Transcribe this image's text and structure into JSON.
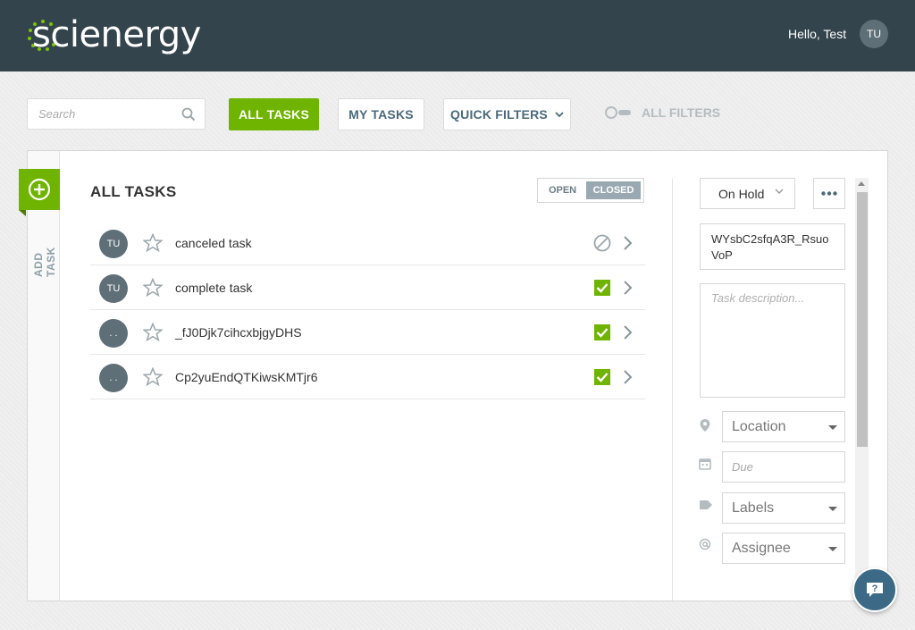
{
  "header": {
    "logo_text": "scienergy",
    "greeting": "Hello, Test",
    "avatar_initials": "TU"
  },
  "toolbar": {
    "search_placeholder": "Search",
    "all_tasks_label": "ALL TASKS",
    "my_tasks_label": "MY TASKS",
    "quick_filters_label": "QUICK FILTERS",
    "all_filters_label": "ALL FILTERS",
    "accent_color": "#6fb400"
  },
  "sidebar": {
    "add_task_label": "ADD TASK"
  },
  "task_list": {
    "title": "ALL TASKS",
    "toggle": {
      "open_label": "OPEN",
      "closed_label": "CLOSED",
      "selected": "CLOSED"
    },
    "tasks": [
      {
        "avatar": "TU",
        "name": "canceled task",
        "status": "canceled",
        "status_icon": "cancel-icon",
        "starred": false
      },
      {
        "avatar": "TU",
        "name": "complete task",
        "status": "complete",
        "status_icon": "check-icon",
        "starred": false
      },
      {
        "avatar": ". .",
        "name": "_fJ0Djk7cihcxbjgyDHS",
        "status": "complete",
        "status_icon": "check-icon",
        "starred": false
      },
      {
        "avatar": ". .",
        "name": "Cp2yuEndQTKiwsKMTjr6",
        "status": "complete",
        "status_icon": "check-icon",
        "starred": false
      }
    ]
  },
  "detail": {
    "status_value": "On Hold",
    "title_value": "WYsbC2sfqA3R_RsuoVoP",
    "description_placeholder": "Task description...",
    "location_placeholder": "Location",
    "due_placeholder": "Due",
    "labels_placeholder": "Labels",
    "assignee_placeholder": "Assignee"
  }
}
